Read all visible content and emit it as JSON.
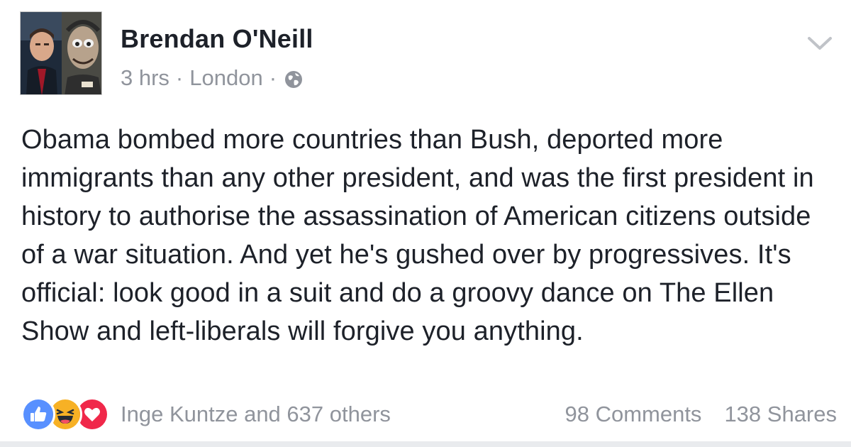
{
  "author": {
    "name": "Brendan O'Neill",
    "avatar_icon": "profile-photo"
  },
  "meta": {
    "time": "3 hrs",
    "separator": "·",
    "location": "London",
    "privacy_icon": "globe-icon"
  },
  "menu": {
    "icon": "chevron-down-icon"
  },
  "post": {
    "text": "Obama bombed more countries than Bush, deported more immigrants than any other president, and was the first president in history to authorise the assassination of American citizens outside of a war situation. And yet he's gushed over by progressives. It's official: look good in a suit and do a groovy dance on The Ellen Show and left-liberals will forgive you anything."
  },
  "footer": {
    "reactions": [
      {
        "type": "like",
        "icon": "like-icon",
        "color": "#5890ff"
      },
      {
        "type": "haha",
        "icon": "haha-icon",
        "color": "#f7b125"
      },
      {
        "type": "love",
        "icon": "love-icon",
        "color": "#f0284a"
      }
    ],
    "reactors": "Inge Kuntze and 637 others",
    "comments": "98 Comments",
    "shares": "138 Shares"
  }
}
